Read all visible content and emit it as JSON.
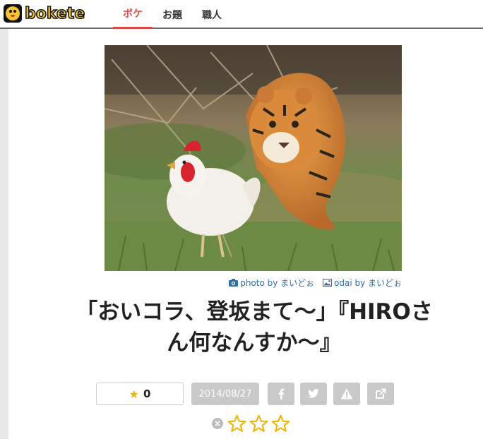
{
  "header": {
    "logo_text": "bokete",
    "nav": [
      {
        "label": "ボケ",
        "active": true
      },
      {
        "label": "お題",
        "active": false
      },
      {
        "label": "職人",
        "active": false
      }
    ]
  },
  "photo": {
    "description_icon": "photo-icon"
  },
  "credits": {
    "photo_label": "photo by まいどぉ",
    "odai_label": "odai by まいどぉ"
  },
  "caption": {
    "line1": "「おいコラ、登坂まて～」『HIROさ",
    "line2": "ん何なんすか～』"
  },
  "actions": {
    "vote_count": "0",
    "date": "2014/08/27",
    "buttons": [
      "facebook-icon",
      "twitter-icon",
      "report-icon",
      "external-link-icon"
    ]
  },
  "rating": {
    "stars": 3,
    "filled": 0
  },
  "colors": {
    "accent": "#e04a4a",
    "link": "#2f6fa8",
    "button_gray": "#c9c9c9",
    "star_gold": "#f0b400"
  }
}
